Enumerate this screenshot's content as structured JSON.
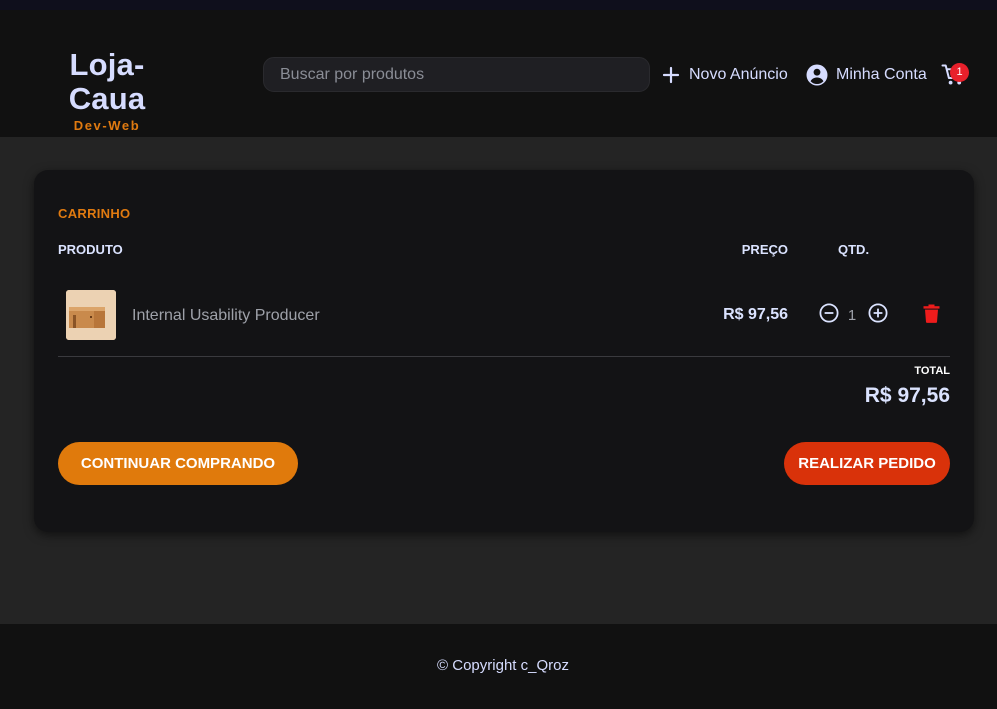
{
  "colors": {
    "accent_orange": "#e07a0c",
    "order_red": "#d9320a",
    "badge_red": "#e8202b",
    "page_bg": "#242424",
    "header_bg": "#111111",
    "card_bg": "#131315",
    "text_light": "#dbe3ff"
  },
  "header": {
    "brand": "Loja-Caua",
    "subtitle": "Dev-Web",
    "search_placeholder": "Buscar por produtos",
    "search_value": "",
    "new_listing_label": "Novo Anúncio",
    "new_listing_icon": "plus-icon",
    "account_label": "Minha Conta",
    "account_icon": "account-circle-icon",
    "cart_icon": "shopping-cart-icon",
    "cart_count": "1"
  },
  "cart": {
    "title": "CARRINHO",
    "columns": {
      "product": "PRODUTO",
      "price": "PREÇO",
      "quantity": "QTD."
    },
    "items": [
      {
        "image_icon": "product-thumbnail",
        "name": "Internal Usability Producer",
        "price": "R$ 97,56",
        "quantity": "1",
        "decrease_icon": "minus-circle-icon",
        "increase_icon": "plus-circle-icon",
        "remove_icon": "trash-icon"
      }
    ],
    "total_label": "TOTAL",
    "total_value": "R$ 97,56",
    "continue_label": "CONTINUAR COMPRANDO",
    "order_label": "REALIZAR PEDIDO"
  },
  "footer": {
    "copyright": "© Copyright c_Qroz"
  }
}
